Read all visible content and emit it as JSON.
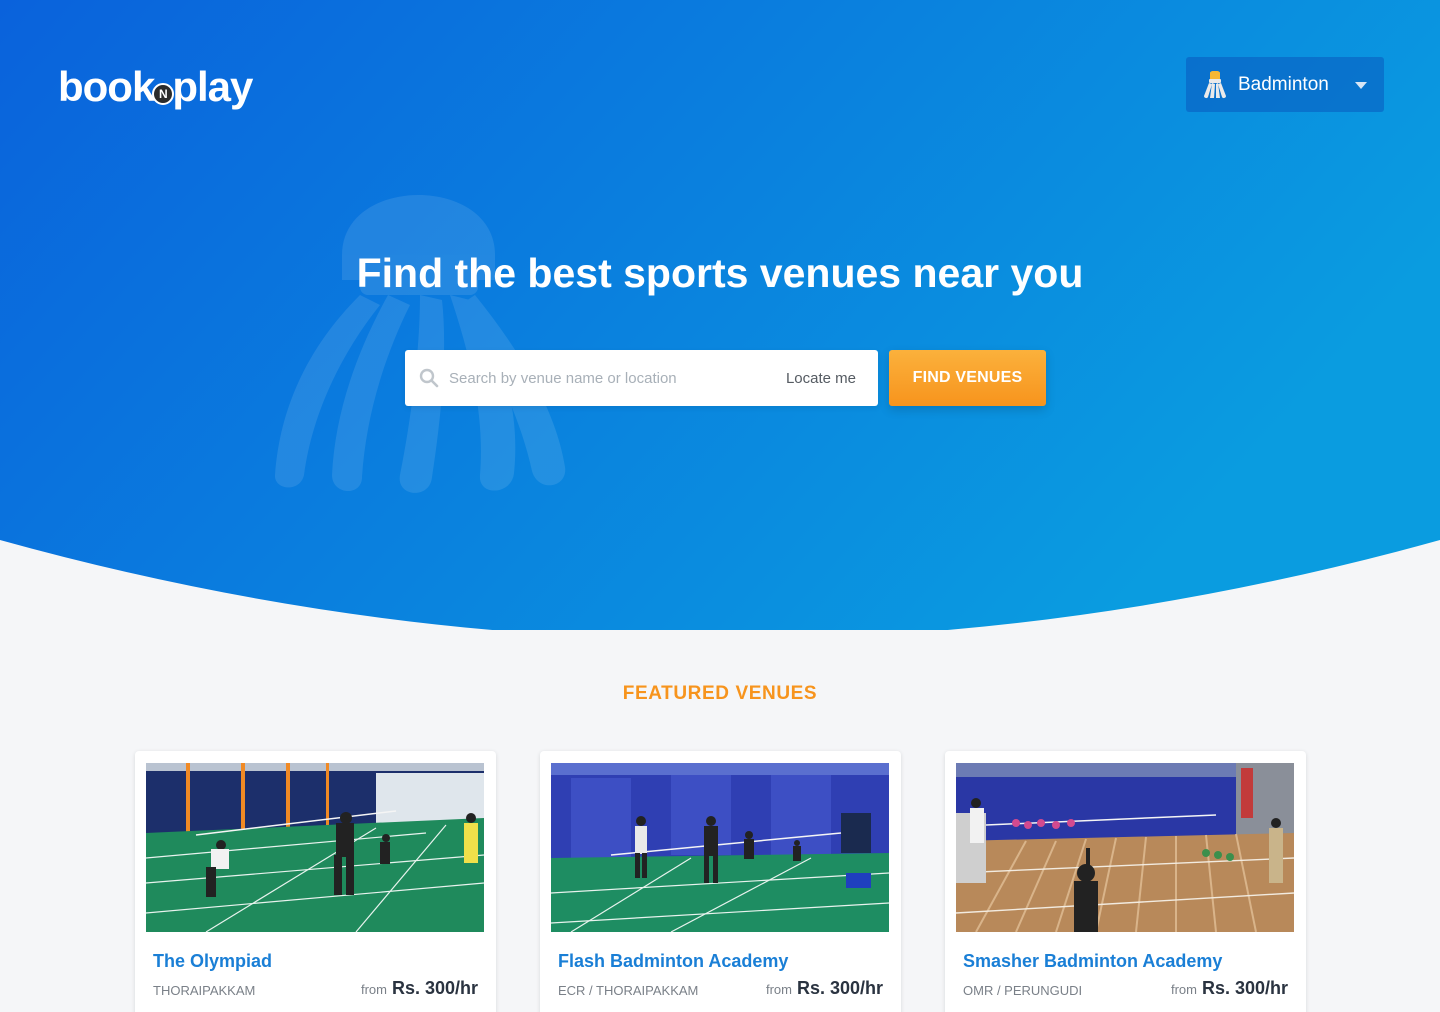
{
  "brand": {
    "logo_prefix": "book",
    "logo_badge": "N",
    "logo_suffix": "play"
  },
  "header": {
    "sport_selector": {
      "selected": "Badminton",
      "icon": "shuttlecock-icon"
    }
  },
  "hero": {
    "title": "Find the best sports venues near you",
    "search": {
      "placeholder": "Search by venue name or location",
      "value": "",
      "locate_label": "Locate me"
    },
    "find_button_label": "FIND VENUES"
  },
  "featured": {
    "title": "FEATURED VENUES",
    "venues": [
      {
        "name": "The Olympiad",
        "location": "THORAIPAKKAM",
        "from_label": "from",
        "price": "Rs. 300/hr"
      },
      {
        "name": "Flash Badminton Academy",
        "location": "ECR / THORAIPAKKAM",
        "from_label": "from",
        "price": "Rs. 300/hr"
      },
      {
        "name": "Smasher Badminton Academy",
        "location": "OMR / PERUNGUDI",
        "from_label": "from",
        "price": "Rs. 300/hr"
      }
    ]
  },
  "colors": {
    "hero_start": "#0a66df",
    "hero_end": "#0a9ae0",
    "accent_orange": "#f7941d",
    "venue_link": "#1a7fd6"
  }
}
